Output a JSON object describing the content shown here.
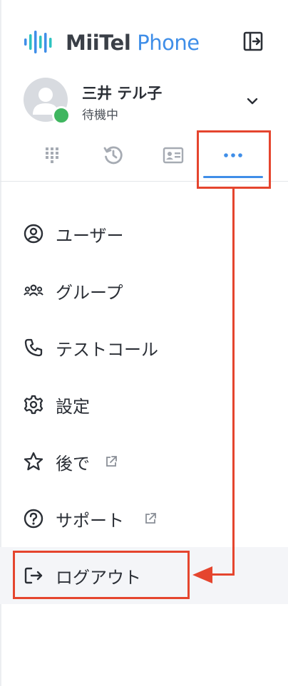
{
  "brand": {
    "name_part1": "MiiTel",
    "name_part2": "Phone",
    "colors": {
      "primary": "#3f8ee8",
      "dark": "#3a3f47"
    }
  },
  "profile": {
    "name": "三井 テル子",
    "status": "待機中",
    "status_color": "#3fb65f"
  },
  "tabs": [
    {
      "icon": "dialpad-icon"
    },
    {
      "icon": "history-icon"
    },
    {
      "icon": "contact-card-icon"
    },
    {
      "icon": "more-icon",
      "selected": true
    }
  ],
  "menu": {
    "items": [
      {
        "label": "ユーザー",
        "icon": "user-circle-icon"
      },
      {
        "label": "グループ",
        "icon": "group-icon"
      },
      {
        "label": "テストコール",
        "icon": "phone-icon"
      },
      {
        "label": "設定",
        "icon": "gear-icon"
      },
      {
        "label": "後で",
        "icon": "star-icon",
        "external": true
      },
      {
        "label": "サポート",
        "icon": "help-circle-icon",
        "external": true
      },
      {
        "label": "ログアウト",
        "icon": "logout-icon",
        "active": true
      }
    ]
  },
  "annotation": {
    "color": "#e5452e"
  }
}
